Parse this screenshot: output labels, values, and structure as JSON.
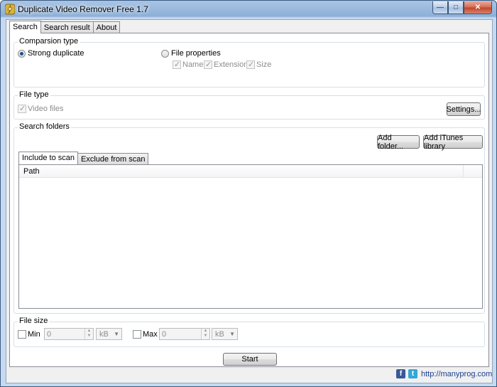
{
  "window": {
    "title": "Duplicate Video Remover Free 1.7"
  },
  "tabs": [
    {
      "label": "Search",
      "active": true
    },
    {
      "label": "Search result",
      "active": false
    },
    {
      "label": "About",
      "active": false
    }
  ],
  "comparison": {
    "legend": "Comparsion type",
    "strong_duplicate": "Strong duplicate",
    "file_properties": "File properties",
    "name": "Name",
    "extension": "Extension",
    "size": "Size"
  },
  "file_type": {
    "legend": "File type",
    "video_files": "Video files",
    "settings_button": "Settings..."
  },
  "search_folders": {
    "legend": "Search folders",
    "add_folder_button": "Add folder...",
    "add_itunes_button": "Add iTunes library",
    "include_tab": "Include to scan",
    "exclude_tab": "Exclude from scan",
    "path_header": "Path"
  },
  "file_size": {
    "legend": "File size",
    "min_label": "Min",
    "min_value": "0",
    "min_unit": "kB",
    "max_label": "Max",
    "max_value": "0",
    "max_unit": "kB"
  },
  "start_button": "Start",
  "footer": {
    "link": "http://manyprog.com"
  },
  "colors": {
    "accent": "#1b4e8f",
    "link": "#1a3f8e",
    "facebook": "#3b5998",
    "twitter": "#33a7d8"
  }
}
